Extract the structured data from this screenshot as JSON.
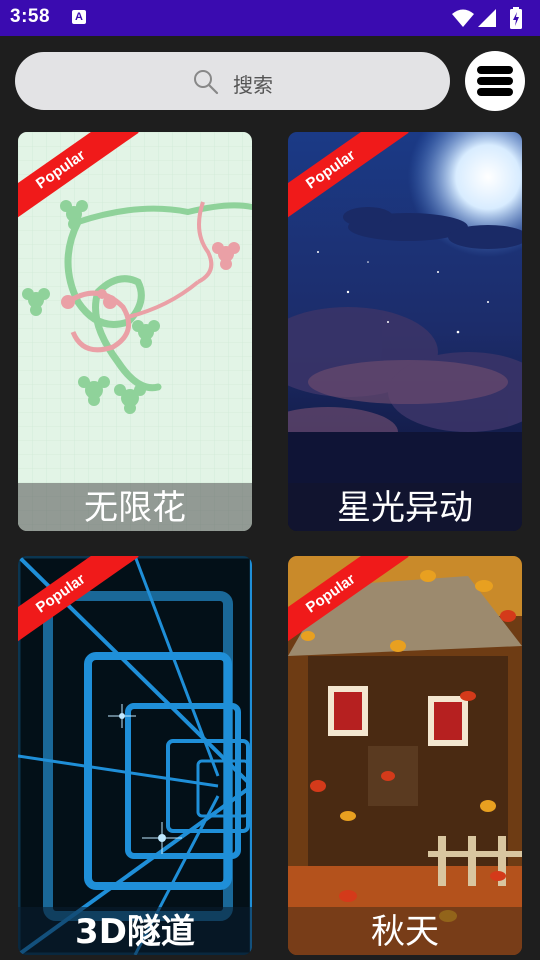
{
  "status_bar": {
    "time": "3:58",
    "app_icon_letter": "A",
    "icons": [
      "wifi-icon",
      "cellular-signal-icon",
      "battery-icon"
    ],
    "background": "#3a0bb0"
  },
  "search": {
    "placeholder": "搜索"
  },
  "menu": {
    "icon": "hamburger-menu-icon"
  },
  "wallpapers": [
    {
      "title": "无限花",
      "badge": "Popular"
    },
    {
      "title": "星光异动",
      "badge": "Popular"
    },
    {
      "title": "3D隧道",
      "badge": "Popular"
    },
    {
      "title": "秋天",
      "badge": "Popular"
    }
  ],
  "colors": {
    "badge": "#f01a1a",
    "background": "#1e1e1e",
    "search_bg": "#e3e3e5"
  }
}
